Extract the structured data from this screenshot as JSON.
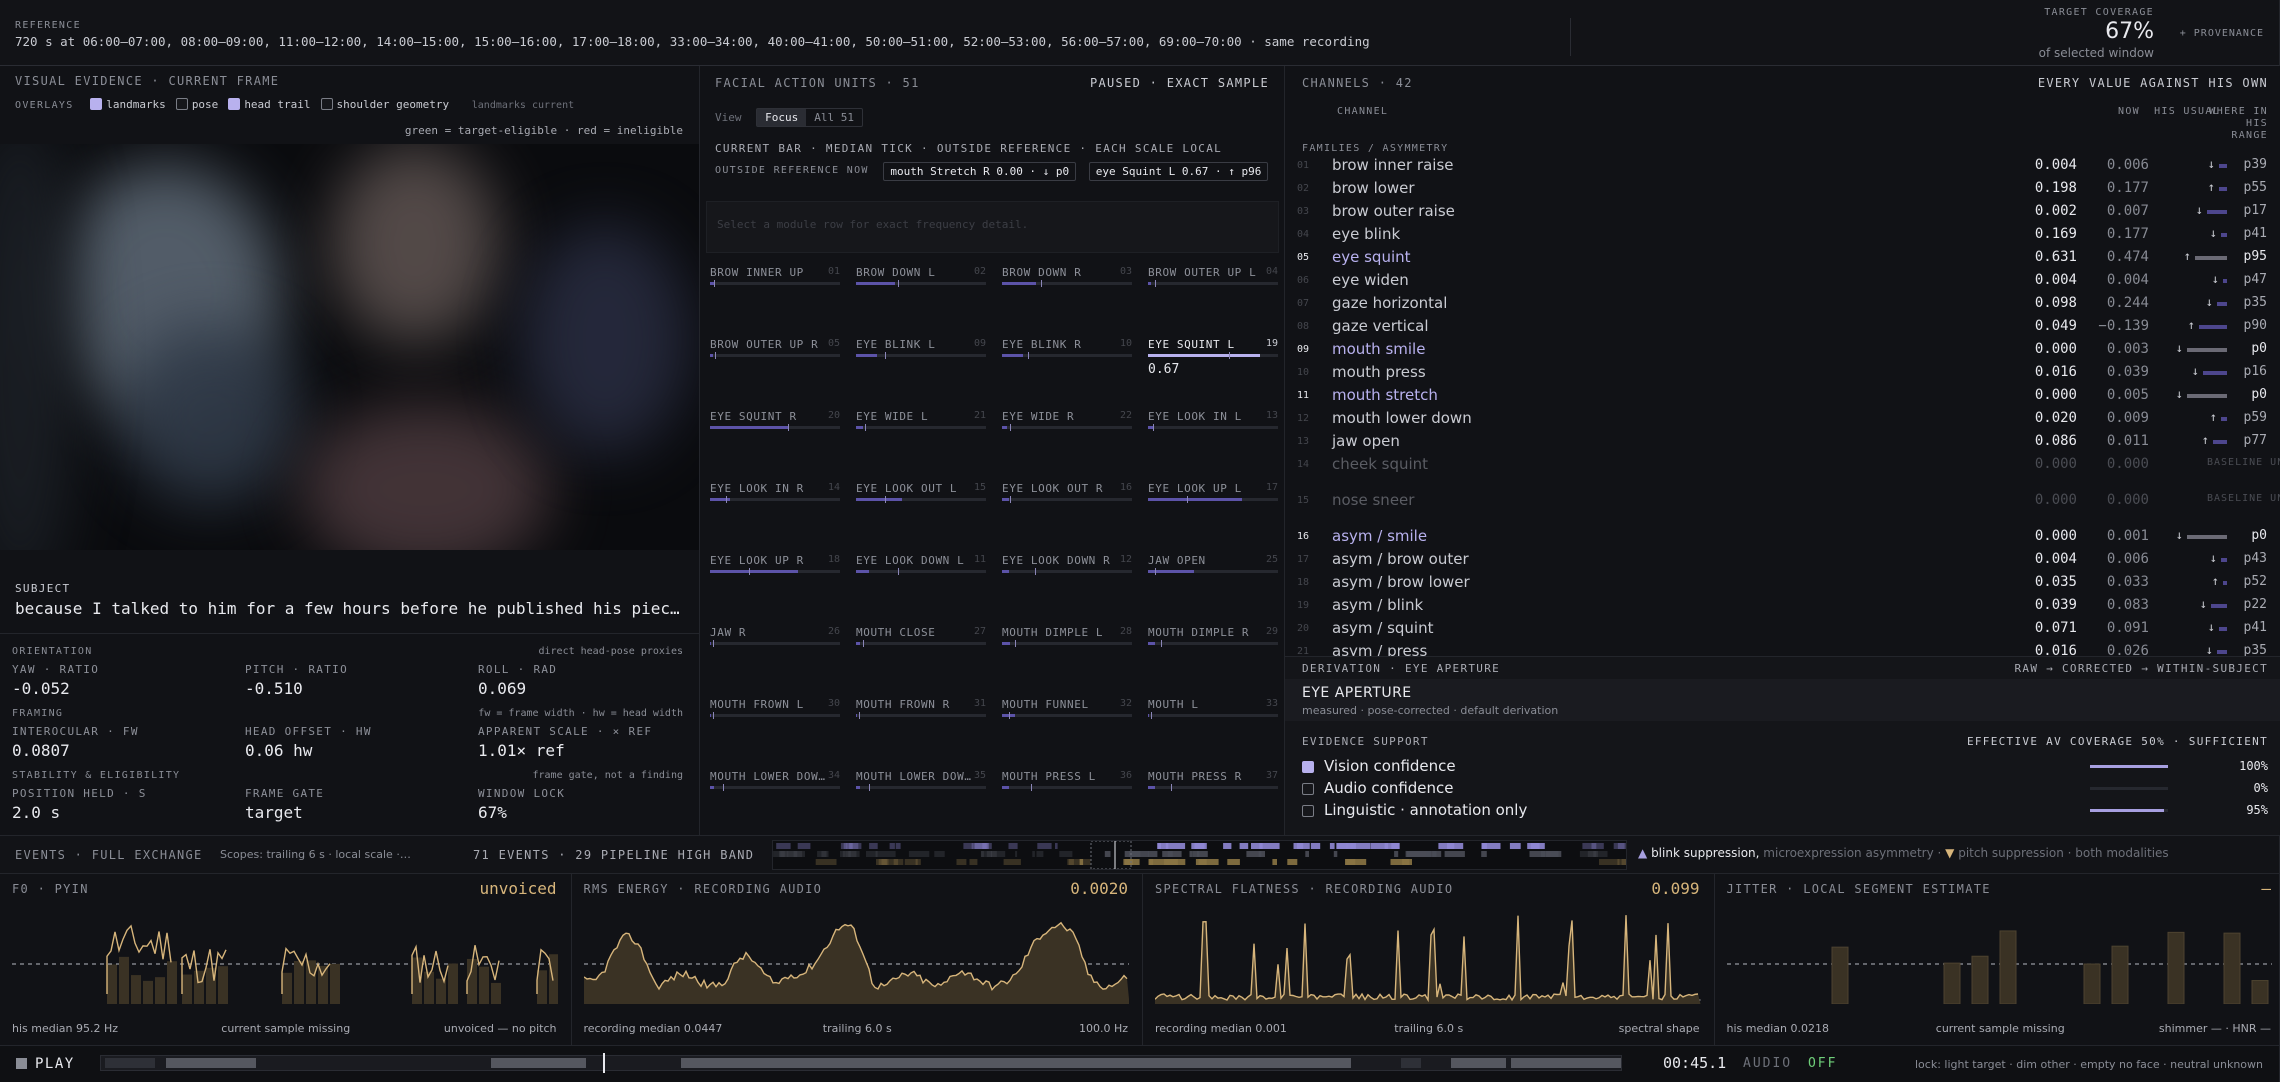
{
  "reference": {
    "label": "REFERENCE",
    "summary": "720 s at 06:00–07:00, 08:00–09:00, 11:00–12:00, 14:00–15:00, 15:00–16:00, 17:00–18:00, 33:00–34:00, 40:00–41:00, 50:00–51:00, 52:00–53:00, 56:00–57:00, 69:00–70:00 · same recording",
    "coverage_label": "TARGET COVERAGE",
    "coverage_value": "67%",
    "coverage_sub": "of selected window",
    "provenance": "+ PROVENANCE"
  },
  "visual": {
    "title": "VISUAL EVIDENCE · CURRENT FRAME",
    "overlays_label": "OVERLAYS",
    "overlays": [
      {
        "label": "landmarks",
        "checked": true
      },
      {
        "label": "pose",
        "checked": false
      },
      {
        "label": "head trail",
        "checked": true
      },
      {
        "label": "shoulder geometry",
        "checked": false
      }
    ],
    "landmarks_state": "landmarks current",
    "legend": "green = target-eligible · red = ineligible"
  },
  "subject": {
    "label": "SUBJECT",
    "text": "because I talked to him for a few hours before he published his piec…"
  },
  "orientation": {
    "label": "ORIENTATION",
    "note": "direct head-pose proxies",
    "cells": [
      {
        "label": "YAW · RATIO",
        "value": "-0.052"
      },
      {
        "label": "PITCH · RATIO",
        "value": "-0.510"
      },
      {
        "label": "ROLL · RAD",
        "value": "0.069"
      }
    ]
  },
  "framing": {
    "label": "FRAMING",
    "note": "fw = frame width · hw = head width",
    "cells": [
      {
        "label": "INTEROCULAR · FW",
        "value": "0.0807"
      },
      {
        "label": "HEAD OFFSET · HW",
        "value": "0.06 hw"
      },
      {
        "label": "APPARENT SCALE · × REF",
        "value": "1.01× ref"
      }
    ]
  },
  "stability": {
    "label": "STABILITY & ELIGIBILITY",
    "note": "frame gate, not a finding",
    "cells": [
      {
        "label": "POSITION HELD · S",
        "value": "2.0 s"
      },
      {
        "label": "FRAME GATE",
        "value": "target"
      },
      {
        "label": "WINDOW LOCK",
        "value": "67%"
      }
    ]
  },
  "facs": {
    "title": "FACIAL ACTION UNITS · 51",
    "status": "PAUSED · EXACT SAMPLE",
    "view_label": "View",
    "tabs": [
      "Focus",
      "All 51"
    ],
    "legend": "CURRENT BAR · MEDIAN TICK · OUTSIDE REFERENCE · EACH SCALE LOCAL",
    "outside_label": "OUTSIDE REFERENCE NOW",
    "outside": [
      "mouth Stretch R 0.00 · ↓ p0",
      "eye Squint L 0.67 · ↑ p96"
    ],
    "notice": "Select a module row for exact frequency detail.",
    "units": [
      {
        "name": "BROW INNER UP",
        "num": "01",
        "fill": 0.03,
        "tick": 0.03
      },
      {
        "name": "BROW DOWN L",
        "num": "02",
        "fill": 0.3,
        "tick": 0.32
      },
      {
        "name": "BROW DOWN R",
        "num": "03",
        "fill": 0.26,
        "tick": 0.3
      },
      {
        "name": "BROW OUTER UP L",
        "num": "04",
        "fill": 0.02,
        "tick": 0.05
      },
      {
        "name": "BROW OUTER UP R",
        "num": "05",
        "fill": 0.02,
        "tick": 0.04
      },
      {
        "name": "EYE BLINK L",
        "num": "09",
        "fill": 0.16,
        "tick": 0.22
      },
      {
        "name": "EYE BLINK R",
        "num": "10",
        "fill": 0.16,
        "tick": 0.2
      },
      {
        "name": "EYE SQUINT L",
        "num": "19",
        "fill": 0.86,
        "tick": 0.62,
        "highlight": true,
        "value": "0.67"
      },
      {
        "name": "EYE SQUINT R",
        "num": "20",
        "fill": 0.6,
        "tick": 0.6
      },
      {
        "name": "EYE WIDE L",
        "num": "21",
        "fill": 0.05,
        "tick": 0.07
      },
      {
        "name": "EYE WIDE R",
        "num": "22",
        "fill": 0.04,
        "tick": 0.06
      },
      {
        "name": "EYE LOOK IN L",
        "num": "13",
        "fill": 0.04,
        "tick": 0.04
      },
      {
        "name": "EYE LOOK IN R",
        "num": "14",
        "fill": 0.15,
        "tick": 0.12
      },
      {
        "name": "EYE LOOK OUT L",
        "num": "15",
        "fill": 0.35,
        "tick": 0.22
      },
      {
        "name": "EYE LOOK OUT R",
        "num": "16",
        "fill": 0.05,
        "tick": 0.06
      },
      {
        "name": "EYE LOOK UP L",
        "num": "17",
        "fill": 0.72,
        "tick": 0.3
      },
      {
        "name": "EYE LOOK UP R",
        "num": "18",
        "fill": 0.68,
        "tick": 0.3
      },
      {
        "name": "EYE LOOK DOWN L",
        "num": "11",
        "fill": 0.1,
        "tick": 0.32
      },
      {
        "name": "EYE LOOK DOWN R",
        "num": "12",
        "fill": 0.05,
        "tick": 0.25
      },
      {
        "name": "JAW OPEN",
        "num": "25",
        "fill": 0.35,
        "tick": 0.05
      },
      {
        "name": "JAW R",
        "num": "26",
        "fill": 0.01,
        "tick": 0.02
      },
      {
        "name": "MOUTH CLOSE",
        "num": "27",
        "fill": 0.03,
        "tick": 0.05
      },
      {
        "name": "MOUTH DIMPLE L",
        "num": "28",
        "fill": 0.06,
        "tick": 0.1
      },
      {
        "name": "MOUTH DIMPLE R",
        "num": "29",
        "fill": 0.05,
        "tick": 0.1
      },
      {
        "name": "MOUTH FROWN L",
        "num": "30",
        "fill": 0.01,
        "tick": 0.02
      },
      {
        "name": "MOUTH FROWN R",
        "num": "31",
        "fill": 0.01,
        "tick": 0.02
      },
      {
        "name": "MOUTH FUNNEL",
        "num": "32",
        "fill": 0.1,
        "tick": 0.05
      },
      {
        "name": "MOUTH L",
        "num": "33",
        "fill": 0.01,
        "tick": 0.02
      },
      {
        "name": "MOUTH LOWER DOW…",
        "num": "34",
        "fill": 0.03,
        "tick": 0.1
      },
      {
        "name": "MOUTH LOWER DOW…",
        "num": "35",
        "fill": 0.03,
        "tick": 0.1
      },
      {
        "name": "MOUTH PRESS L",
        "num": "36",
        "fill": 0.05,
        "tick": 0.22
      },
      {
        "name": "MOUTH PRESS R",
        "num": "37",
        "fill": 0.05,
        "tick": 0.18
      }
    ]
  },
  "channels": {
    "title": "CHANNELS · 42",
    "subtitle": "EVERY VALUE AGAINST HIS OWN",
    "col_channel": "CHANNEL",
    "col_now": "NOW",
    "col_usual": "HIS USUAL",
    "col_range": "WHERE IN HIS RANGE",
    "group": "FAMILIES / ASYMMETRY",
    "rows": [
      {
        "num": "01",
        "name": "brow inner raise",
        "now": "0.004",
        "usual": "0.006",
        "dir": "↓",
        "bar": 8,
        "p": "p39"
      },
      {
        "num": "02",
        "name": "brow lower",
        "now": "0.198",
        "usual": "0.177",
        "dir": "↑",
        "bar": 8,
        "p": "p55"
      },
      {
        "num": "03",
        "name": "brow outer raise",
        "now": "0.002",
        "usual": "0.007",
        "dir": "↓",
        "bar": 20,
        "p": "p17"
      },
      {
        "num": "04",
        "name": "eye blink",
        "now": "0.169",
        "usual": "0.177",
        "dir": "↓",
        "bar": 6,
        "p": "p41"
      },
      {
        "num": "05",
        "name": "eye squint",
        "now": "0.631",
        "usual": "0.474",
        "dir": "↑",
        "bar": 32,
        "p": "p95",
        "hl": true
      },
      {
        "num": "06",
        "name": "eye widen",
        "now": "0.004",
        "usual": "0.004",
        "dir": "↓",
        "bar": 4,
        "p": "p47"
      },
      {
        "num": "07",
        "name": "gaze horizontal",
        "now": "0.098",
        "usual": "0.244",
        "dir": "↓",
        "bar": 10,
        "p": "p35"
      },
      {
        "num": "08",
        "name": "gaze vertical",
        "now": "0.049",
        "usual": "−0.139",
        "dir": "↑",
        "bar": 28,
        "p": "p90"
      },
      {
        "num": "09",
        "name": "mouth smile",
        "now": "0.000",
        "usual": "0.003",
        "dir": "↓",
        "bar": 40,
        "p": "p0",
        "hl": true
      },
      {
        "num": "10",
        "name": "mouth press",
        "now": "0.016",
        "usual": "0.039",
        "dir": "↓",
        "bar": 24,
        "p": "p16"
      },
      {
        "num": "11",
        "name": "mouth stretch",
        "now": "0.000",
        "usual": "0.005",
        "dir": "↓",
        "bar": 40,
        "p": "p0",
        "hl": true
      },
      {
        "num": "12",
        "name": "mouth lower down",
        "now": "0.020",
        "usual": "0.009",
        "dir": "↑",
        "bar": 6,
        "p": "p59"
      },
      {
        "num": "13",
        "name": "jaw open",
        "now": "0.086",
        "usual": "0.011",
        "dir": "↑",
        "bar": 14,
        "p": "p77"
      },
      {
        "num": "14",
        "name": "cheek squint",
        "now": "0.000",
        "usual": "0.000",
        "unavailable": "BASELINE UNAVAILABLE"
      },
      {
        "num": "15",
        "name": "nose sneer",
        "now": "0.000",
        "usual": "0.000",
        "unavailable": "BASELINE UNAVAILABLE"
      },
      {
        "num": "16",
        "name": "asym / smile",
        "now": "0.000",
        "usual": "0.001",
        "dir": "↓",
        "bar": 40,
        "p": "p0",
        "hl": true
      },
      {
        "num": "17",
        "name": "asym / brow outer",
        "now": "0.004",
        "usual": "0.006",
        "dir": "↓",
        "bar": 6,
        "p": "p43"
      },
      {
        "num": "18",
        "name": "asym / brow lower",
        "now": "0.035",
        "usual": "0.033",
        "dir": "↑",
        "bar": 4,
        "p": "p52"
      },
      {
        "num": "19",
        "name": "asym / blink",
        "now": "0.039",
        "usual": "0.083",
        "dir": "↓",
        "bar": 16,
        "p": "p22"
      },
      {
        "num": "20",
        "name": "asym / squint",
        "now": "0.071",
        "usual": "0.091",
        "dir": "↓",
        "bar": 8,
        "p": "p41"
      },
      {
        "num": "21",
        "name": "asym / press",
        "now": "0.016",
        "usual": "0.026",
        "dir": "↓",
        "bar": 10,
        "p": "p35"
      }
    ]
  },
  "derivation": {
    "label": "DERIVATION · EYE APERTURE",
    "flow": "RAW → CORRECTED → WITHIN-SUBJECT",
    "title": "EYE APERTURE",
    "sub": "measured · pose-corrected · default derivation"
  },
  "evidence": {
    "label": "EVIDENCE SUPPORT",
    "summary": "EFFECTIVE AV COVERAGE 50% · SUFFICIENT",
    "items": [
      {
        "label": "Vision confidence",
        "value": "100%",
        "level": 1.0,
        "checked": true
      },
      {
        "label": "Audio confidence",
        "value": "0%",
        "level": 0.0,
        "checked": false
      },
      {
        "label": "Linguistic · annotation only",
        "value": "95%",
        "level": 0.95,
        "checked": false
      }
    ]
  },
  "events": {
    "label": "EVENTS · FULL EXCHANGE",
    "scopes": "Scopes: trailing 6 s · local scale ·…",
    "count": "71 EVENTS · 29 PIPELINE HIGH BAND",
    "legend_a": "blink suppression,",
    "legend_b": "microexpression asymmetry ·",
    "legend_c": "pitch suppression · both modalities"
  },
  "audio": [
    {
      "title": "F0 · PYIN",
      "value": "unvoiced",
      "foot_l": "his median 95.2 Hz",
      "foot_m": "current sample missing",
      "foot_r": "unvoiced — no pitch"
    },
    {
      "title": "RMS ENERGY · RECORDING AUDIO",
      "value": "0.0020",
      "foot_l": "recording median 0.0447",
      "foot_m": "trailing 6.0 s",
      "foot_r": "100.0 Hz"
    },
    {
      "title": "SPECTRAL FLATNESS · RECORDING AUDIO",
      "value": "0.099",
      "foot_l": "recording median 0.001",
      "foot_m": "trailing 6.0 s",
      "foot_r": "spectral shape"
    },
    {
      "title": "JITTER · LOCAL SEGMENT ESTIMATE",
      "value": "—",
      "foot_l": "his median 0.0218",
      "foot_m": "current sample missing",
      "foot_r": "shimmer — · HNR —"
    }
  ],
  "transport": {
    "play": "PLAY",
    "time": "00:45.1",
    "audio_label": "AUDIO",
    "audio_state": "OFF",
    "legend": "lock: light target · dim other · empty no face · neutral unknown",
    "progress": 0.33
  },
  "colors": {
    "accent": "#a79fe0",
    "amber": "#d7b57b",
    "green": "#6fcf7a",
    "bg": "#111216"
  }
}
